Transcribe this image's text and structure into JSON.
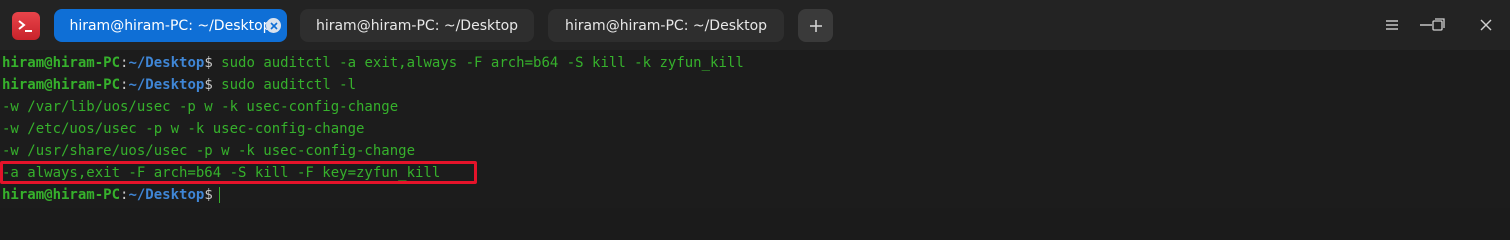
{
  "titlebar": {
    "app_icon": "terminal-icon",
    "tabs": [
      {
        "label": "hiram@hiram-PC: ~/Desktop",
        "active": true
      },
      {
        "label": "hiram@hiram-PC: ~/Desktop",
        "active": false
      },
      {
        "label": "hiram@hiram-PC: ~/Desktop",
        "active": false
      }
    ],
    "new_tab_icon": "plus-icon",
    "window_controls": [
      "menu-icon",
      "minimize-icon",
      "maximize-icon",
      "close-icon"
    ]
  },
  "terminal": {
    "prompt": {
      "user": "hiram@hiram-PC",
      "colon": ":",
      "path": "~/Desktop",
      "dollar": "$"
    },
    "lines": [
      {
        "type": "prompt",
        "command": " sudo auditctl -a exit,always -F arch=b64 -S kill -k zyfun_kill"
      },
      {
        "type": "prompt",
        "command": " sudo auditctl -l"
      },
      {
        "type": "output",
        "text": "-w /var/lib/uos/usec -p w -k usec-config-change"
      },
      {
        "type": "output",
        "text": "-w /etc/uos/usec -p w -k usec-config-change"
      },
      {
        "type": "output",
        "text": "-w /usr/share/uos/usec -p w -k usec-config-change"
      },
      {
        "type": "output",
        "text": "-a always,exit -F arch=b64 -S kill -F key=zyfun_kill"
      },
      {
        "type": "prompt",
        "command": ""
      }
    ],
    "highlighted_line_index": 5
  },
  "colors": {
    "active_tab": "#0f6fd6",
    "text_green": "#36b12c",
    "path_blue": "#3f86d6",
    "highlight_red": "#e5132a"
  }
}
